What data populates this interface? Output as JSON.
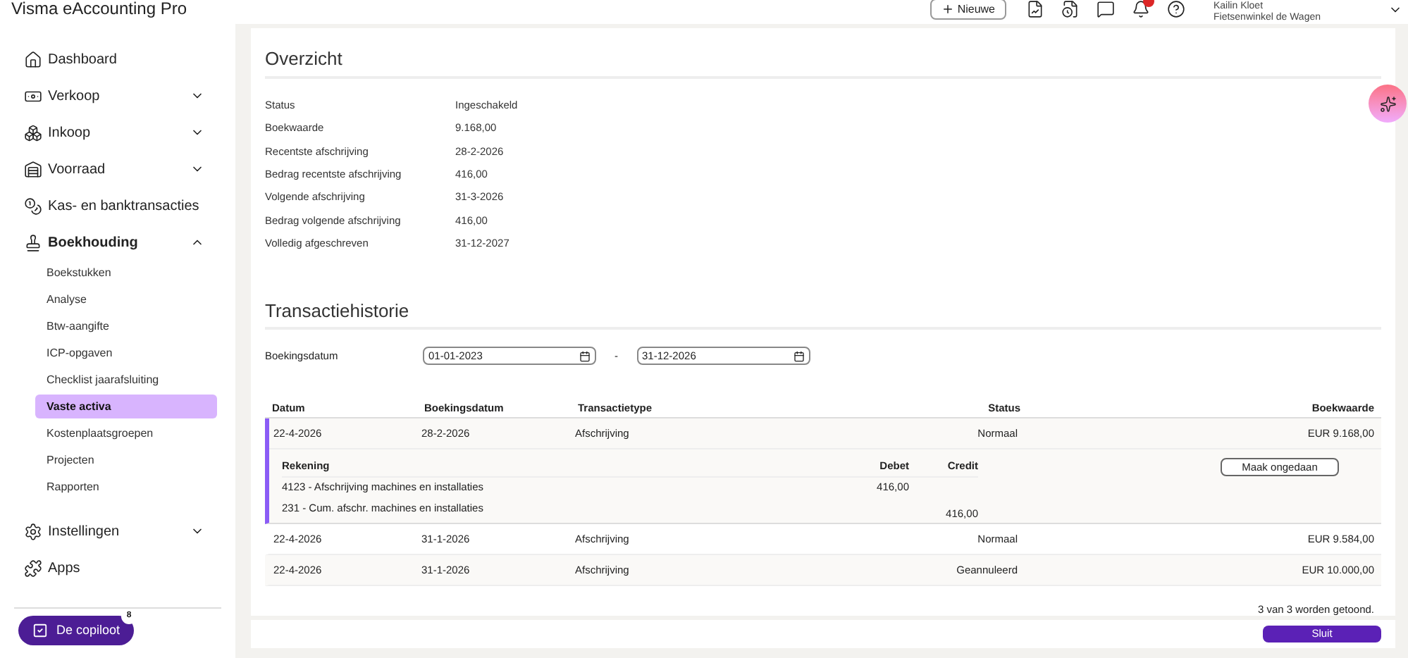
{
  "app_title": "Visma eAccounting Pro",
  "header": {
    "new_button": "Nieuwe",
    "notifications_unread": true,
    "user_name": "Kailin Kloet",
    "company": "Fietsenwinkel de Wagen"
  },
  "sidebar": {
    "items": [
      {
        "label": "Dashboard"
      },
      {
        "label": "Verkoop",
        "expanded": false
      },
      {
        "label": "Inkoop",
        "expanded": false
      },
      {
        "label": "Voorraad",
        "expanded": false
      },
      {
        "label": "Kas- en banktransacties"
      },
      {
        "label": "Boekhouding",
        "expanded": true,
        "children": [
          {
            "label": "Boekstukken",
            "selected": false
          },
          {
            "label": "Analyse",
            "selected": false
          },
          {
            "label": "Btw-aangifte",
            "selected": false
          },
          {
            "label": "ICP-opgaven",
            "selected": false
          },
          {
            "label": "Checklist jaarafsluiting",
            "selected": false
          },
          {
            "label": "Vaste activa",
            "selected": true
          },
          {
            "label": "Kostenplaatsgroepen",
            "selected": false
          },
          {
            "label": "Projecten",
            "selected": false
          },
          {
            "label": "Rapporten",
            "selected": false
          }
        ]
      },
      {
        "label": "Instellingen",
        "expanded": false
      },
      {
        "label": "Apps"
      }
    ],
    "copilot": {
      "label": "De copiloot",
      "badge": "8"
    }
  },
  "overview": {
    "title": "Overzicht",
    "fields": [
      {
        "label": "Status",
        "value": "Ingeschakeld"
      },
      {
        "label": "Boekwaarde",
        "value": "9.168,00"
      },
      {
        "label": "Recentste afschrijving",
        "value": "28-2-2026"
      },
      {
        "label": "Bedrag recentste afschrijving",
        "value": "416,00"
      },
      {
        "label": "Volgende afschrijving",
        "value": "31-3-2026"
      },
      {
        "label": "Bedrag volgende afschrijving",
        "value": "416,00"
      },
      {
        "label": "Volledig afgeschreven",
        "value": "31-12-2027"
      }
    ]
  },
  "history": {
    "title": "Transactiehistorie",
    "filter_label": "Boekingsdatum",
    "date_from": "01-01-2023",
    "separator": "-",
    "date_to": "31-12-2026",
    "columns": [
      "Datum",
      "Boekingsdatum",
      "Transactietype",
      "Status",
      "Boekwaarde"
    ],
    "rows": [
      {
        "cells": [
          "22-4-2026",
          "28-2-2026",
          "Afschrijving",
          "Normaal",
          "EUR 9.168,00"
        ],
        "expanded": true,
        "detail": {
          "columns": [
            "Rekening",
            "Debet",
            "Credit"
          ],
          "lines": [
            {
              "account": "4123 - Afschrijving machines en installaties",
              "debit": "416,00"
            },
            {
              "account": "231 - Cum. afschr. machines en installaties",
              "credit": "416,00"
            }
          ],
          "action": "Maak ongedaan"
        }
      },
      {
        "cells": [
          "22-4-2026",
          "31-1-2026",
          "Afschrijving",
          "Normaal",
          "EUR 9.584,00"
        ],
        "expanded": false
      },
      {
        "cells": [
          "22-4-2026",
          "31-1-2026",
          "Afschrijving",
          "Geannuleerd",
          "EUR 10.000,00"
        ],
        "expanded": false
      }
    ],
    "count_text": "3 van 3 worden getoond."
  },
  "footer": {
    "close_button": "Sluit"
  }
}
